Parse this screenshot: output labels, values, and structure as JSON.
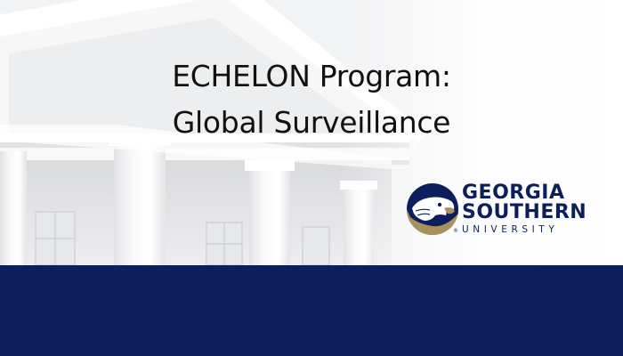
{
  "slide": {
    "title_line1": "ECHELON Program:",
    "title_line2": "Global Surveillance"
  },
  "logo": {
    "line1": "GEORGIA",
    "line2": "SOUTHERN",
    "line3": "UNIVERSITY",
    "registered_mark": "®",
    "icon": "eagle-head-icon"
  },
  "colors": {
    "navy": "#0c1f5c",
    "gold": "#a9915b",
    "title_text": "#111111"
  }
}
